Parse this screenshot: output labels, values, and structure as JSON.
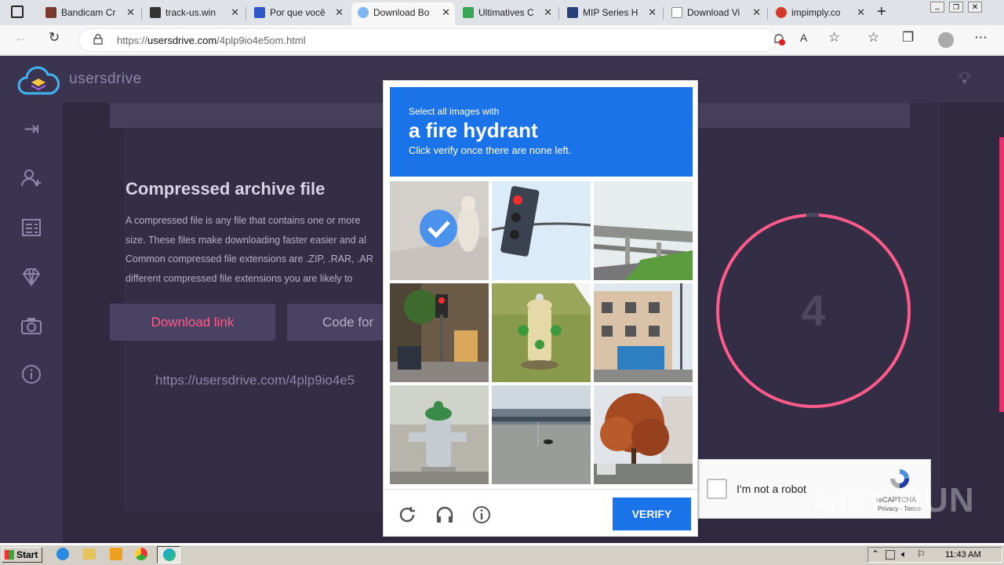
{
  "browser": {
    "tabs": [
      {
        "label": "Bandicam Cr",
        "color": "#7a3b2e"
      },
      {
        "label": "track-us.win",
        "color": "#333333"
      },
      {
        "label": "Por que você",
        "color": "#2e56c7"
      },
      {
        "label": "Download Bo",
        "color": "#7cb7f0"
      },
      {
        "label": "Ultimatives C",
        "color": "#3aa655"
      },
      {
        "label": "MIP Series H",
        "color": "#2b3f7a"
      },
      {
        "label": "Download Vi",
        "color": "#888888"
      },
      {
        "label": "impimply.co",
        "color": "#d53b2a"
      }
    ],
    "url_prefix": "https://",
    "url_host": "usersdrive.com",
    "url_path": "/4plp9io4e5om.html"
  },
  "site": {
    "brand": "usersdrive",
    "file_type_title": "Compressed archive file",
    "description_lines": [
      "A compressed file is any file that contains one or more",
      "size. These files make downloading faster easier and al",
      "Common compressed file extensions are .ZIP, .RAR, .AR",
      "different compressed file extensions you are likely to"
    ],
    "download_btn": "Download link",
    "code_btn": "Code for",
    "link_text": "https://usersdrive.com/4plp9io4e5",
    "countdown": "4",
    "sidebar_icons": [
      "sign-in-icon",
      "add-user-icon",
      "invoice-icon",
      "diamond-icon",
      "camera-icon",
      "info-icon"
    ]
  },
  "captcha": {
    "prompt_small": "Select all images with",
    "prompt_big": "a fire hydrant",
    "prompt_hint": "Click verify once there are none left.",
    "verify_label": "VERIFY",
    "tiles": [
      {
        "name": "tile-statue",
        "selected": true
      },
      {
        "name": "tile-traffic-light",
        "selected": false
      },
      {
        "name": "tile-overpass",
        "selected": false
      },
      {
        "name": "tile-street-traffic-light",
        "selected": false
      },
      {
        "name": "tile-yellow-hydrant",
        "selected": false
      },
      {
        "name": "tile-building",
        "selected": false
      },
      {
        "name": "tile-green-hydrant",
        "selected": false
      },
      {
        "name": "tile-highway",
        "selected": false
      },
      {
        "name": "tile-tree",
        "selected": false
      }
    ]
  },
  "recaptcha": {
    "label": "I'm not a robot",
    "brand": "reCAPTCHA",
    "links": "Privacy - Terms"
  },
  "watermark": "ANY RUN",
  "taskbar": {
    "start": "Start",
    "clock": "11:43 AM"
  }
}
